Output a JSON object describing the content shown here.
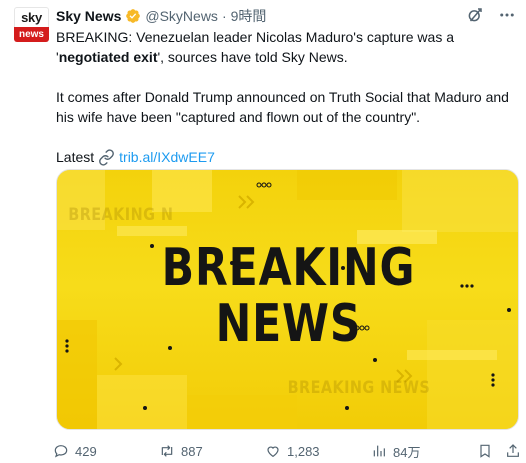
{
  "author": {
    "display_name": "Sky News",
    "handle": "@SkyNews",
    "separator": "·",
    "time": "9時間",
    "avatar_top": "sky",
    "avatar_bottom": "news"
  },
  "tweet": {
    "line1_prefix": "BREAKING: Venezuelan leader Nicolas Maduro's capture was a '",
    "line1_bold": "negotiated exit",
    "line1_suffix": "', sources have told Sky News.",
    "para2": "It comes after Donald Trump announced on Truth Social that Maduro and his wife have been \"captured and flown out of the country\".",
    "latest_label": "Latest",
    "link_text": "trib.al/IXdwEE7"
  },
  "media": {
    "line1": "BREAKING",
    "line2": "NEWS",
    "ghost_top": "BREAKING N",
    "ghost_bottom": "BREAKING NEWS",
    "colors": {
      "background": "#f4d30f",
      "text": "#151515"
    }
  },
  "actions": {
    "replies": "429",
    "reposts": "887",
    "likes": "1,283",
    "views": "84万"
  },
  "icons": {
    "verified": "verified-badge-icon",
    "grok": "grok-icon",
    "more": "more-icon",
    "link": "link-icon",
    "reply": "reply-icon",
    "repost": "repost-icon",
    "like": "heart-icon",
    "views": "views-icon",
    "bookmark": "bookmark-icon",
    "share": "share-icon"
  },
  "colors": {
    "link": "#1d9bf0",
    "muted": "#536471",
    "verified": "#f7b928"
  }
}
